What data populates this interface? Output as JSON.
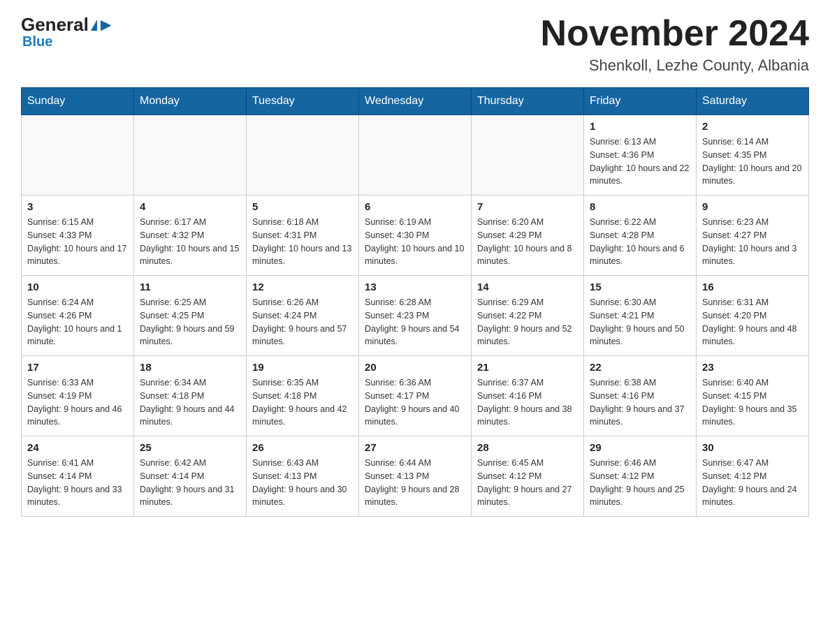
{
  "logo": {
    "general": "General",
    "blue": "Blue",
    "triangle": "▶"
  },
  "title": "November 2024",
  "location": "Shenkoll, Lezhe County, Albania",
  "weekdays": [
    "Sunday",
    "Monday",
    "Tuesday",
    "Wednesday",
    "Thursday",
    "Friday",
    "Saturday"
  ],
  "weeks": [
    [
      {
        "day": "",
        "info": ""
      },
      {
        "day": "",
        "info": ""
      },
      {
        "day": "",
        "info": ""
      },
      {
        "day": "",
        "info": ""
      },
      {
        "day": "",
        "info": ""
      },
      {
        "day": "1",
        "info": "Sunrise: 6:13 AM\nSunset: 4:36 PM\nDaylight: 10 hours and 22 minutes."
      },
      {
        "day": "2",
        "info": "Sunrise: 6:14 AM\nSunset: 4:35 PM\nDaylight: 10 hours and 20 minutes."
      }
    ],
    [
      {
        "day": "3",
        "info": "Sunrise: 6:15 AM\nSunset: 4:33 PM\nDaylight: 10 hours and 17 minutes."
      },
      {
        "day": "4",
        "info": "Sunrise: 6:17 AM\nSunset: 4:32 PM\nDaylight: 10 hours and 15 minutes."
      },
      {
        "day": "5",
        "info": "Sunrise: 6:18 AM\nSunset: 4:31 PM\nDaylight: 10 hours and 13 minutes."
      },
      {
        "day": "6",
        "info": "Sunrise: 6:19 AM\nSunset: 4:30 PM\nDaylight: 10 hours and 10 minutes."
      },
      {
        "day": "7",
        "info": "Sunrise: 6:20 AM\nSunset: 4:29 PM\nDaylight: 10 hours and 8 minutes."
      },
      {
        "day": "8",
        "info": "Sunrise: 6:22 AM\nSunset: 4:28 PM\nDaylight: 10 hours and 6 minutes."
      },
      {
        "day": "9",
        "info": "Sunrise: 6:23 AM\nSunset: 4:27 PM\nDaylight: 10 hours and 3 minutes."
      }
    ],
    [
      {
        "day": "10",
        "info": "Sunrise: 6:24 AM\nSunset: 4:26 PM\nDaylight: 10 hours and 1 minute."
      },
      {
        "day": "11",
        "info": "Sunrise: 6:25 AM\nSunset: 4:25 PM\nDaylight: 9 hours and 59 minutes."
      },
      {
        "day": "12",
        "info": "Sunrise: 6:26 AM\nSunset: 4:24 PM\nDaylight: 9 hours and 57 minutes."
      },
      {
        "day": "13",
        "info": "Sunrise: 6:28 AM\nSunset: 4:23 PM\nDaylight: 9 hours and 54 minutes."
      },
      {
        "day": "14",
        "info": "Sunrise: 6:29 AM\nSunset: 4:22 PM\nDaylight: 9 hours and 52 minutes."
      },
      {
        "day": "15",
        "info": "Sunrise: 6:30 AM\nSunset: 4:21 PM\nDaylight: 9 hours and 50 minutes."
      },
      {
        "day": "16",
        "info": "Sunrise: 6:31 AM\nSunset: 4:20 PM\nDaylight: 9 hours and 48 minutes."
      }
    ],
    [
      {
        "day": "17",
        "info": "Sunrise: 6:33 AM\nSunset: 4:19 PM\nDaylight: 9 hours and 46 minutes."
      },
      {
        "day": "18",
        "info": "Sunrise: 6:34 AM\nSunset: 4:18 PM\nDaylight: 9 hours and 44 minutes."
      },
      {
        "day": "19",
        "info": "Sunrise: 6:35 AM\nSunset: 4:18 PM\nDaylight: 9 hours and 42 minutes."
      },
      {
        "day": "20",
        "info": "Sunrise: 6:36 AM\nSunset: 4:17 PM\nDaylight: 9 hours and 40 minutes."
      },
      {
        "day": "21",
        "info": "Sunrise: 6:37 AM\nSunset: 4:16 PM\nDaylight: 9 hours and 38 minutes."
      },
      {
        "day": "22",
        "info": "Sunrise: 6:38 AM\nSunset: 4:16 PM\nDaylight: 9 hours and 37 minutes."
      },
      {
        "day": "23",
        "info": "Sunrise: 6:40 AM\nSunset: 4:15 PM\nDaylight: 9 hours and 35 minutes."
      }
    ],
    [
      {
        "day": "24",
        "info": "Sunrise: 6:41 AM\nSunset: 4:14 PM\nDaylight: 9 hours and 33 minutes."
      },
      {
        "day": "25",
        "info": "Sunrise: 6:42 AM\nSunset: 4:14 PM\nDaylight: 9 hours and 31 minutes."
      },
      {
        "day": "26",
        "info": "Sunrise: 6:43 AM\nSunset: 4:13 PM\nDaylight: 9 hours and 30 minutes."
      },
      {
        "day": "27",
        "info": "Sunrise: 6:44 AM\nSunset: 4:13 PM\nDaylight: 9 hours and 28 minutes."
      },
      {
        "day": "28",
        "info": "Sunrise: 6:45 AM\nSunset: 4:12 PM\nDaylight: 9 hours and 27 minutes."
      },
      {
        "day": "29",
        "info": "Sunrise: 6:46 AM\nSunset: 4:12 PM\nDaylight: 9 hours and 25 minutes."
      },
      {
        "day": "30",
        "info": "Sunrise: 6:47 AM\nSunset: 4:12 PM\nDaylight: 9 hours and 24 minutes."
      }
    ]
  ]
}
